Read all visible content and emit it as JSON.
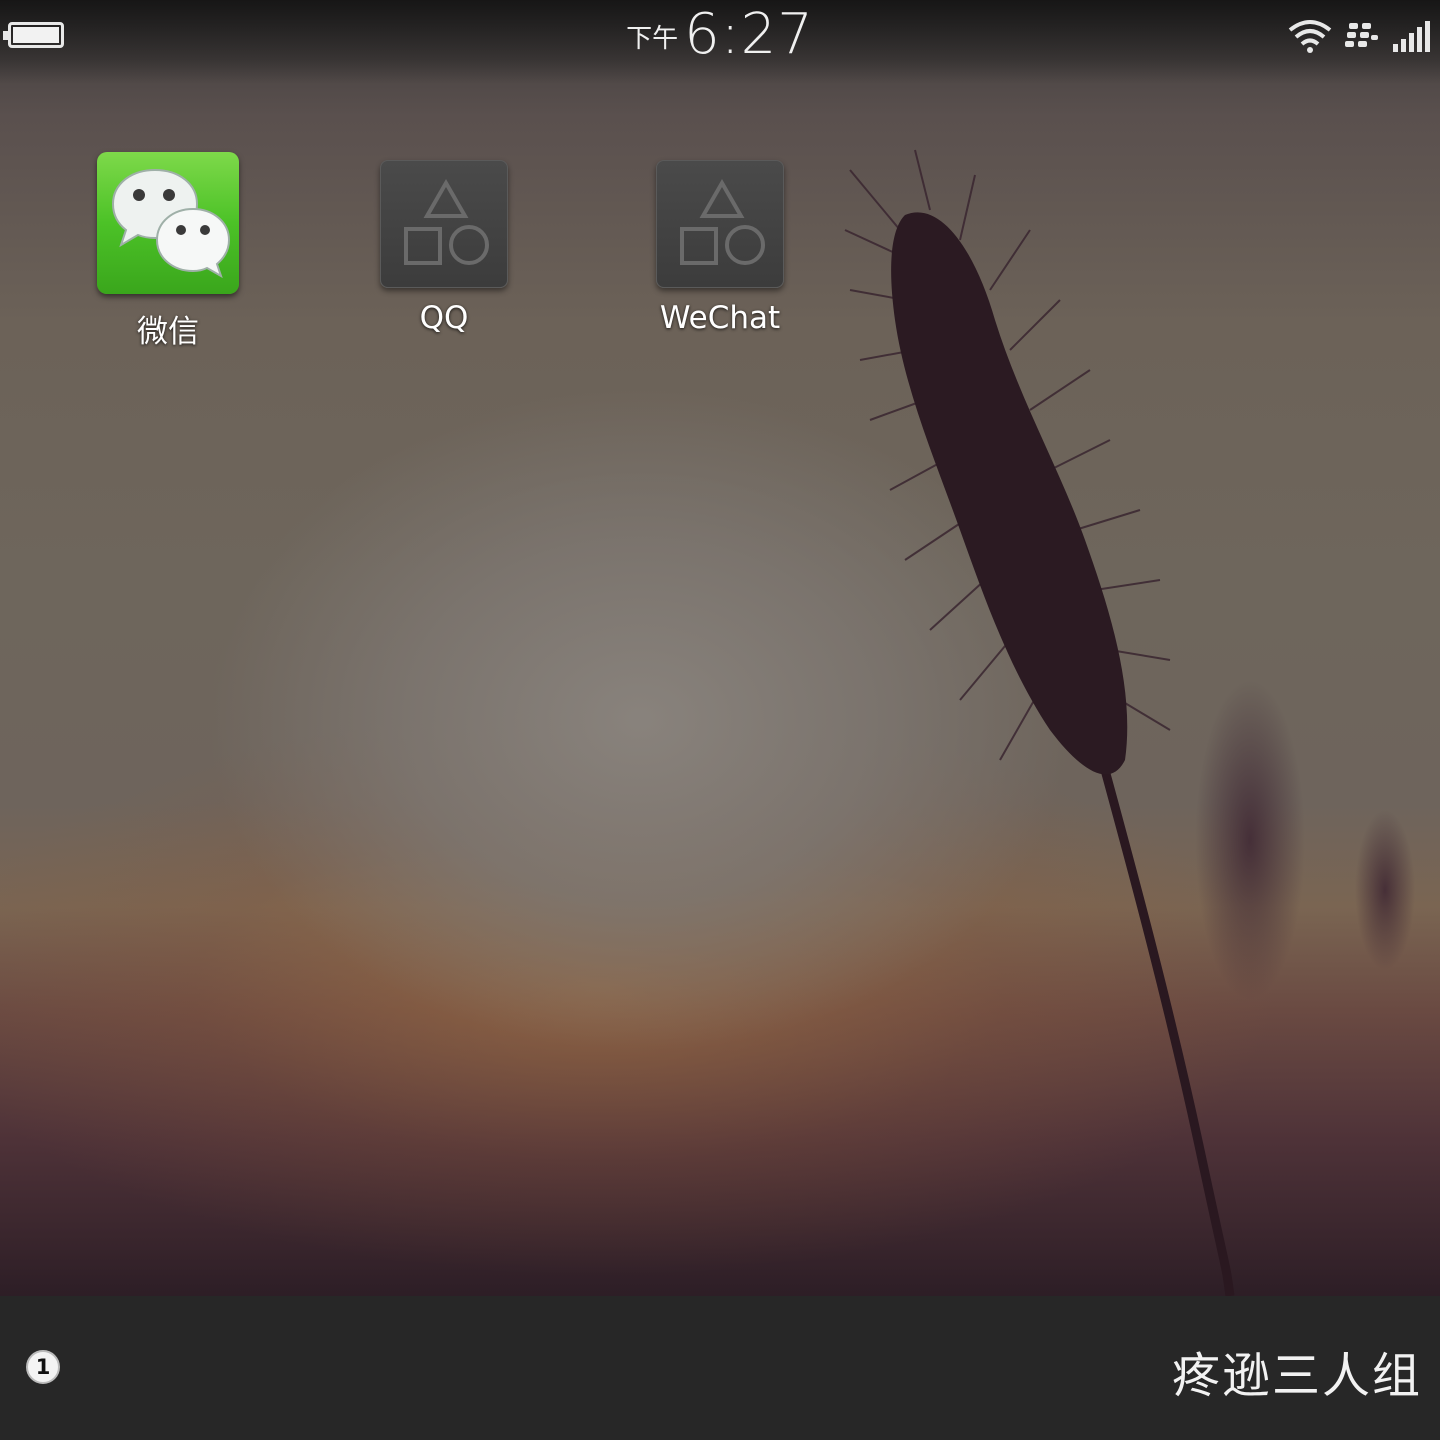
{
  "status_bar": {
    "ampm": "下午",
    "time": "6:27",
    "battery_icon": "battery-full-icon",
    "wifi_icon": "wifi-icon",
    "bbm_icon": "blackberry-icon",
    "signal_icon": "signal-icon"
  },
  "apps": [
    {
      "label": "微信",
      "icon": "wechat-icon",
      "color": "#4cc227"
    },
    {
      "label": "QQ",
      "icon": "placeholder-shapes-icon"
    },
    {
      "label": "WeChat",
      "icon": "placeholder-shapes-icon"
    }
  ],
  "bottom_bar": {
    "badge_count": "1",
    "title": "疼逊三人组"
  }
}
